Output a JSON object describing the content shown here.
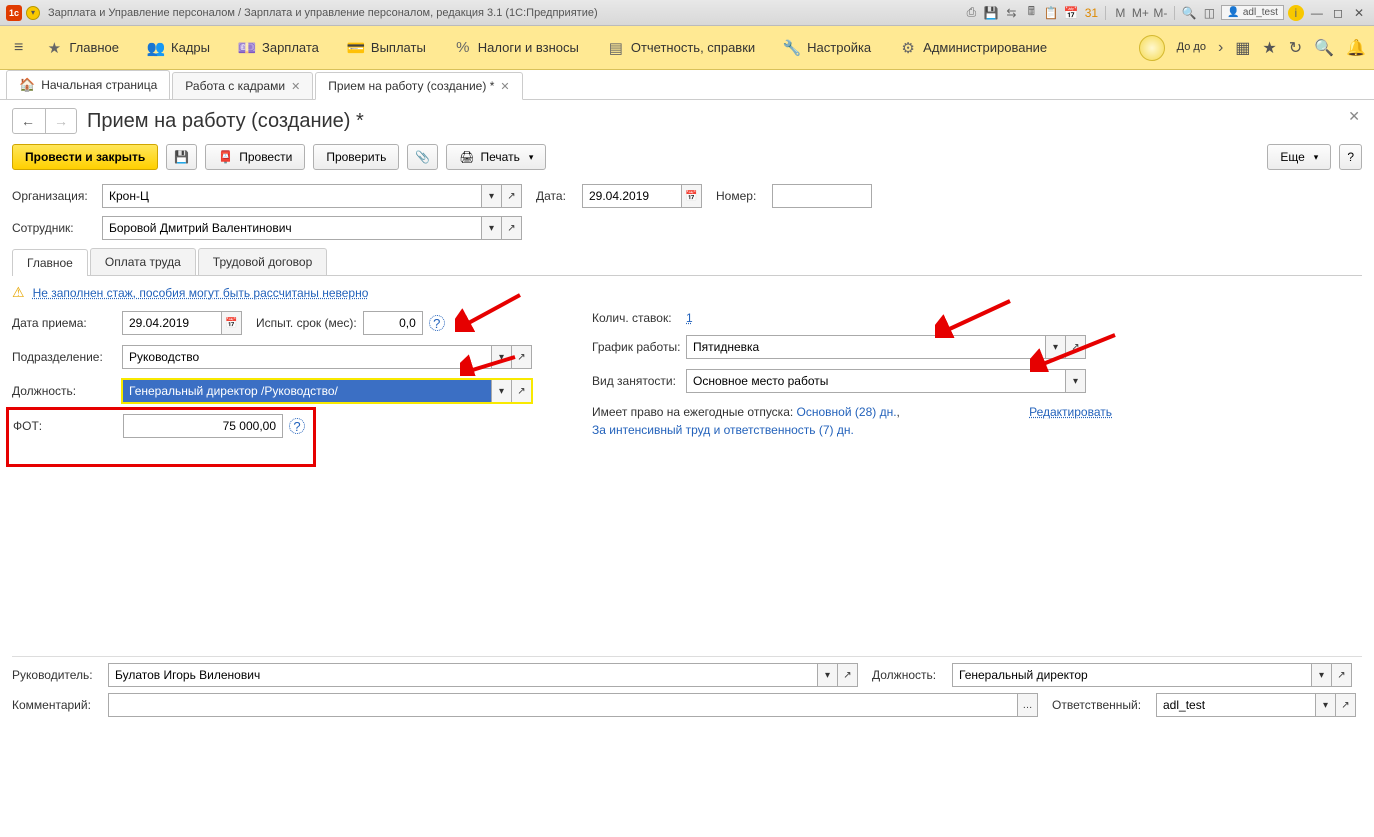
{
  "titlebar": {
    "app_title": "Зарплата и Управление персоналом / Зарплата и управление персоналом, редакция 3.1  (1С:Предприятие)",
    "user": "adl_test",
    "m": "M",
    "m_plus": "M+",
    "m_minus": "M-"
  },
  "mainnav": {
    "items": [
      "Главное",
      "Кадры",
      "Зарплата",
      "Выплаты",
      "Налоги и взносы",
      "Отчетность, справки",
      "Настройка",
      "Администрирование"
    ],
    "right_label": "До\nдо"
  },
  "tabs": {
    "home": "Начальная страница",
    "t1": "Работа с кадрами",
    "t2": "Прием на работу (создание) *"
  },
  "page": {
    "title": "Прием на работу (создание) *"
  },
  "toolbar": {
    "commit_close": "Провести и закрыть",
    "commit": "Провести",
    "check": "Проверить",
    "print": "Печать",
    "more": "Еще",
    "help": "?"
  },
  "fields": {
    "org_label": "Организация:",
    "org_value": "Крон-Ц",
    "date_label": "Дата:",
    "date_value": "29.04.2019",
    "number_label": "Номер:",
    "employee_label": "Сотрудник:",
    "employee_value": "Боровой Дмитрий Валентинович"
  },
  "subtabs": [
    "Главное",
    "Оплата труда",
    "Трудовой договор"
  ],
  "main": {
    "warning": "Не заполнен стаж, пособия могут быть рассчитаны неверно",
    "hire_date_label": "Дата приема:",
    "hire_date_value": "29.04.2019",
    "probation_label": "Испыт. срок (мес):",
    "probation_value": "0,0",
    "dept_label": "Подразделение:",
    "dept_value": "Руководство",
    "position_label": "Должность:",
    "position_value": "Генеральный директор /Руководство/",
    "fot_label": "ФОТ:",
    "fot_value": "75 000,00",
    "rates_label": "Колич. ставок:",
    "rates_value": "1",
    "schedule_label": "График работы:",
    "schedule_value": "Пятидневка",
    "employment_label": "Вид занятости:",
    "employment_value": "Основное место работы",
    "vacation_prefix": "Имеет право на ежегодные отпуска: ",
    "vacation_main": "Основной (28) дн.",
    "vacation_sep": ",  ",
    "vacation_extra": "За интенсивный труд и ответственность (7) дн.",
    "vacation_edit": "Редактировать"
  },
  "footer": {
    "manager_label": "Руководитель:",
    "manager_value": "Булатов Игорь Виленович",
    "manager_pos_label": "Должность:",
    "manager_pos_value": "Генеральный директор",
    "comment_label": "Комментарий:",
    "responsible_label": "Ответственный:",
    "responsible_value": "adl_test"
  }
}
